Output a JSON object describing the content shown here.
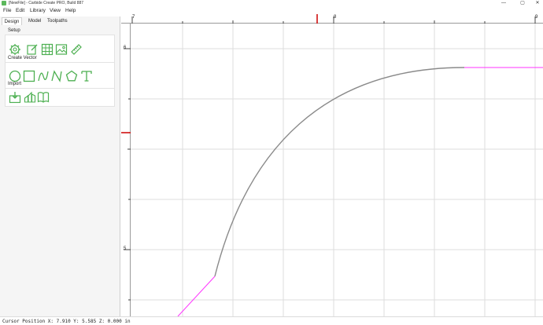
{
  "window": {
    "title": "[NewFile] - Carbide Create PRO, Build 887",
    "min_glyph": "—",
    "max_glyph": "▢",
    "close_glyph": "✕"
  },
  "menu": [
    "File",
    "Edit",
    "Library",
    "View",
    "Help"
  ],
  "tabs": [
    "Design",
    "Model",
    "Toolpaths"
  ],
  "sections": {
    "setup": {
      "label": "Setup",
      "icons": [
        "gear-icon",
        "edit-icon",
        "grid-icon",
        "image-icon",
        "ruler-icon"
      ]
    },
    "create_vector": {
      "label": "Create Vector",
      "icons": [
        "circle-icon",
        "rectangle-icon",
        "curve-icon",
        "polyline-icon",
        "polygon-icon",
        "text-icon"
      ]
    },
    "import": {
      "label": "Import",
      "icons": [
        "import-icon",
        "import-3d-icon",
        "library-icon"
      ]
    }
  },
  "rulers": {
    "top_labels": [
      "7",
      "8",
      "9"
    ],
    "left_labels": [
      "6",
      "5"
    ]
  },
  "status": {
    "cursor_position": "Cursor Position X: 7.910 Y: 5.585 Z: 0.000 in"
  },
  "colors": {
    "accent_green": "#4caf50",
    "selection_magenta": "#ff33ff",
    "curve_gray": "#8a8a8a",
    "grid": "#dddddd",
    "ruler_marker": "#cc0000"
  }
}
